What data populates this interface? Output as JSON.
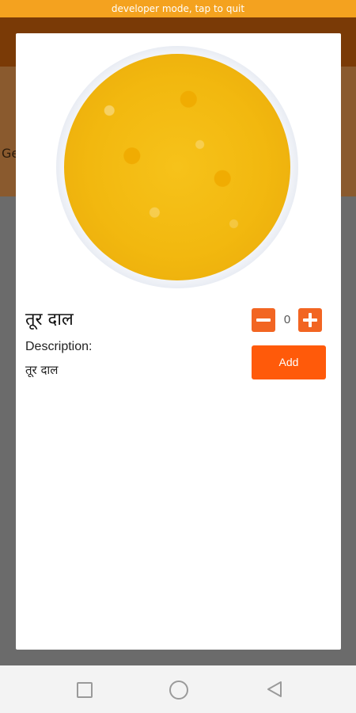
{
  "dev_banner": "developer mode, tap to quit",
  "background": {
    "peek_left": "Ge"
  },
  "dialog": {
    "product_name": "तूर दाल",
    "description_label": "Description:",
    "description_value": "तूर दाल",
    "quantity": "0",
    "add_label": "Add",
    "accent_color": "#ff5a0a"
  },
  "navbar": {
    "icons": [
      "recents-square-icon",
      "home-circle-icon",
      "back-triangle-icon"
    ]
  }
}
